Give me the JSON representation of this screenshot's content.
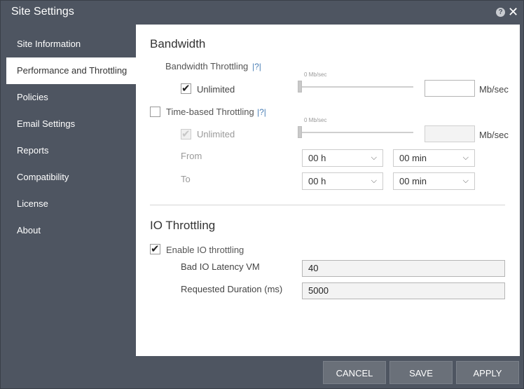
{
  "window": {
    "title": "Site Settings",
    "help_icon": "help-icon",
    "close_icon": "close-icon"
  },
  "sidebar": {
    "items": [
      {
        "label": "Site Information",
        "active": false
      },
      {
        "label": "Performance and Throttling",
        "active": true
      },
      {
        "label": "Policies",
        "active": false
      },
      {
        "label": "Email Settings",
        "active": false
      },
      {
        "label": "Reports",
        "active": false
      },
      {
        "label": "Compatibility",
        "active": false
      },
      {
        "label": "License",
        "active": false
      },
      {
        "label": "About",
        "active": false
      }
    ]
  },
  "bandwidth": {
    "heading": "Bandwidth",
    "throttling_label": "Bandwidth Throttling",
    "help_link": "|?|",
    "unlimited_label": "Unlimited",
    "unlimited_checked": true,
    "slider_caption": "0 Mb/sec",
    "slider_value": 0,
    "value": "",
    "unit": "Mb/sec"
  },
  "time_based": {
    "label": "Time-based Throttling",
    "help_link": "|?|",
    "checked": false,
    "unlimited_label": "Unlimited",
    "unlimited_checked": true,
    "slider_caption": "0 Mb/sec",
    "slider_value": 0,
    "value": "",
    "unit": "Mb/sec",
    "from_label": "From",
    "to_label": "To",
    "from_hour": "00 h",
    "from_min": "00 min",
    "to_hour": "00 h",
    "to_min": "00 min"
  },
  "io": {
    "heading": "IO Throttling",
    "enable_label": "Enable IO throttling",
    "enable_checked": true,
    "latency_label": "Bad IO Latency VM",
    "latency_value": "40",
    "duration_label": "Requested Duration (ms)",
    "duration_value": "5000"
  },
  "footer": {
    "cancel": "CANCEL",
    "save": "SAVE",
    "apply": "APPLY"
  },
  "colors": {
    "chrome": "#4e5561",
    "active_nav": "#ffffff",
    "button": "#6a7079",
    "link": "#4a7fb5"
  }
}
